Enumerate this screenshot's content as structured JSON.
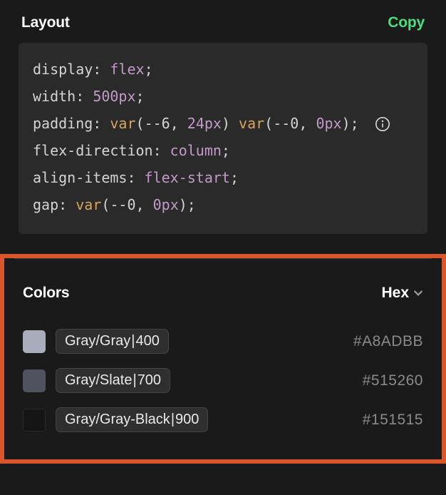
{
  "layout_section": {
    "title": "Layout",
    "copy_label": "Copy",
    "code": {
      "lines": [
        {
          "prop": "display",
          "value_kw": "flex"
        },
        {
          "prop": "width",
          "value_kw": "500px"
        },
        {
          "prop": "padding",
          "func": "var",
          "args1_var": "--6",
          "args1_val": "24px",
          "func2": "var",
          "args2_var": "--0",
          "args2_val": "0px",
          "info": true
        },
        {
          "prop": "flex-direction",
          "value_kw": "column"
        },
        {
          "prop": "align-items",
          "value_kw": "flex-start"
        },
        {
          "prop": "gap",
          "func": "var",
          "args1_var": "--0",
          "args1_val": "0px"
        }
      ]
    }
  },
  "colors_section": {
    "title": "Colors",
    "format": "Hex",
    "items": [
      {
        "swatch": "#A8ADBB",
        "name_prefix": "Gray/Gray ",
        "name_suffix": "400",
        "hex": "#A8ADBB"
      },
      {
        "swatch": "#515260",
        "name_prefix": "Gray/Slate ",
        "name_suffix": "700",
        "hex": "#515260"
      },
      {
        "swatch": "#151515",
        "name_prefix": "Gray/Gray-Black ",
        "name_suffix": "900",
        "hex": "#151515"
      }
    ]
  }
}
